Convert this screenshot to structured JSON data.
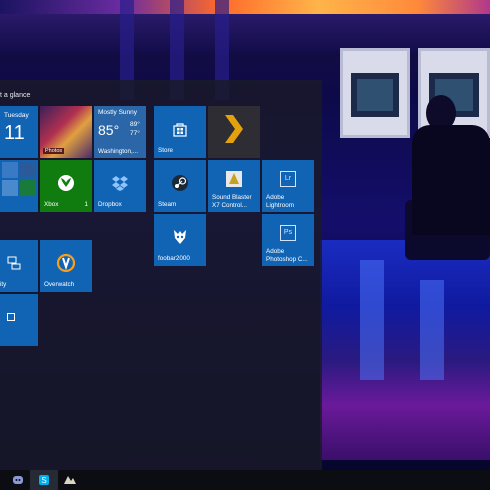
{
  "start_menu": {
    "group_label": "t a glance",
    "tiles": {
      "calendar": {
        "day": "Tuesday",
        "date": "11"
      },
      "photos": {
        "badge": "Photos"
      },
      "weather": {
        "condition": "Mostly Sunny",
        "temp": "85°",
        "high": "89°",
        "low": "77°",
        "city": "Washington,..."
      },
      "store": {
        "label": "Store"
      },
      "plex": {
        "label": ""
      },
      "xbox": {
        "label": "Xbox",
        "count": "1"
      },
      "dropbox": {
        "label": "Dropbox"
      },
      "steam": {
        "label": "Steam"
      },
      "sound_blaster": {
        "label_line1": "Sound Blaster",
        "label_line2": "X7 Control..."
      },
      "lightroom": {
        "label_line1": "Adobe",
        "label_line2": "Lightroom",
        "icon_text": "Lr"
      },
      "foobar": {
        "label": "foobar2000"
      },
      "photoshop": {
        "label_line1": "Adobe",
        "label_line2": "Photoshop C...",
        "icon_text": "Ps"
      },
      "accessibility": {
        "label": "ity"
      },
      "overwatch": {
        "label": "Overwatch"
      }
    }
  },
  "taskbar": {
    "items": [
      "discord-icon",
      "skype-icon",
      "app-icon"
    ]
  },
  "colors": {
    "tile_blue": "#1164b4",
    "xbox_green": "#107c10",
    "plex_orange": "#e5a00d"
  }
}
